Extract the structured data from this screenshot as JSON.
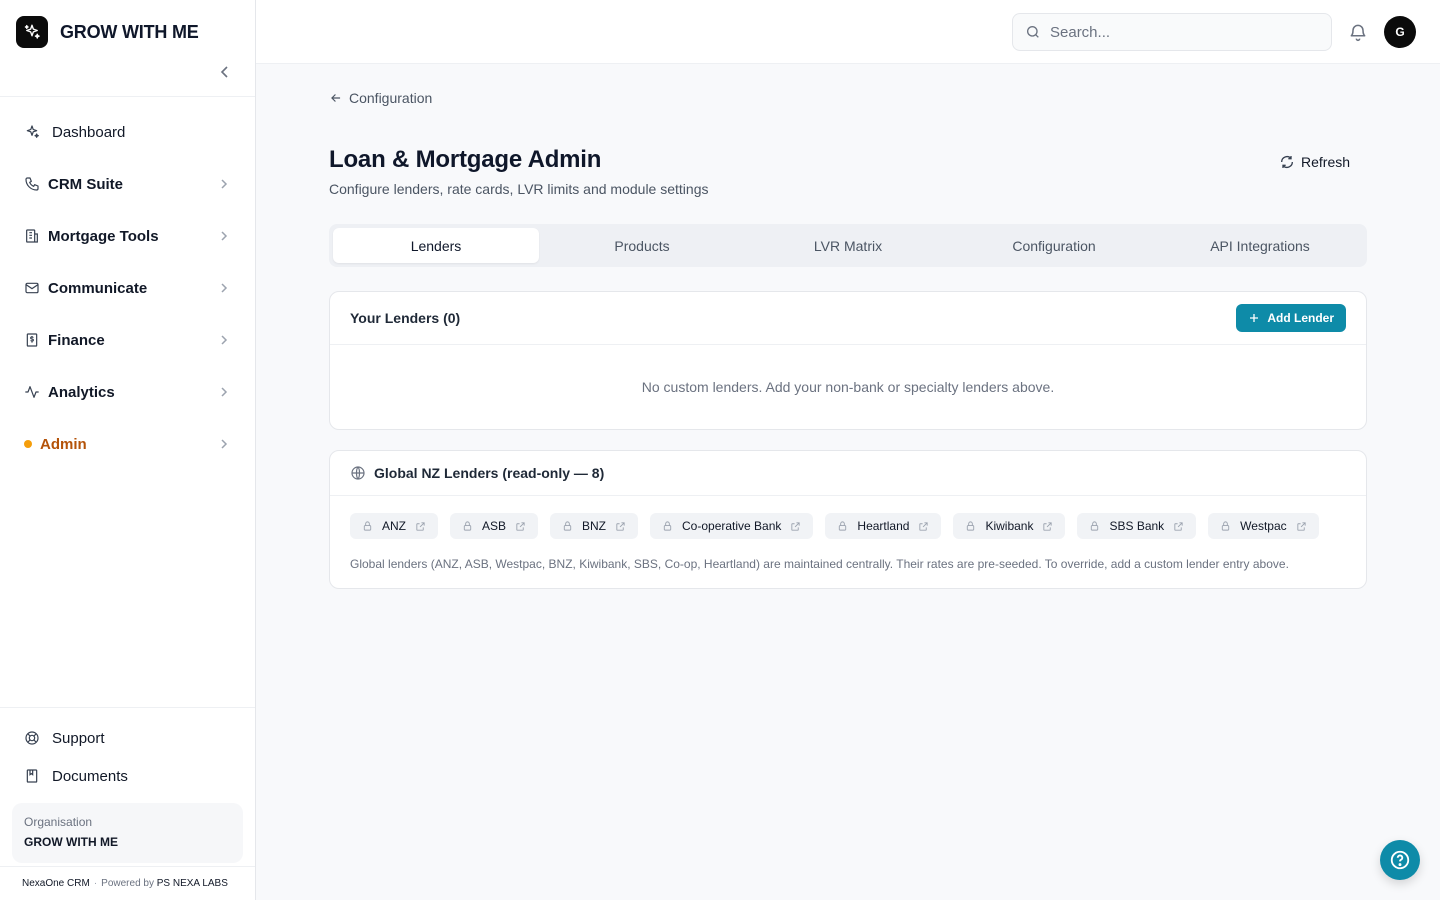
{
  "brand": {
    "name": "GROW WITH ME"
  },
  "sidebar": {
    "items": [
      {
        "label": "Dashboard",
        "icon": "sparkles-icon"
      },
      {
        "label": "CRM Suite",
        "icon": "phone-icon"
      },
      {
        "label": "Mortgage Tools",
        "icon": "building-icon"
      },
      {
        "label": "Communicate",
        "icon": "mail-icon"
      },
      {
        "label": "Finance",
        "icon": "receipt-icon"
      },
      {
        "label": "Analytics",
        "icon": "activity-icon"
      },
      {
        "label": "Admin",
        "icon": "dot-icon",
        "accent": "#b45309"
      }
    ],
    "bottom": [
      {
        "label": "Support",
        "icon": "lifebuoy-icon"
      },
      {
        "label": "Documents",
        "icon": "book-icon"
      }
    ],
    "organisation": {
      "label": "Organisation",
      "name": "GROW WITH ME"
    },
    "footer": {
      "product": "NexaOne CRM",
      "separator": "·",
      "powered_label": "Powered by",
      "company": "PS NEXA LABS"
    }
  },
  "topbar": {
    "search_placeholder": "Search...",
    "avatar_initial": "G"
  },
  "page": {
    "back_label": "Configuration",
    "title": "Loan & Mortgage Admin",
    "subtitle": "Configure lenders, rate cards, LVR limits and module settings",
    "refresh_label": "Refresh",
    "tabs": [
      {
        "label": "Lenders",
        "active": true
      },
      {
        "label": "Products",
        "active": false
      },
      {
        "label": "LVR Matrix",
        "active": false
      },
      {
        "label": "Configuration",
        "active": false
      },
      {
        "label": "API Integrations",
        "active": false
      }
    ]
  },
  "your_lenders": {
    "title": "Your Lenders (0)",
    "add_label": "Add Lender",
    "empty_text": "No custom lenders. Add your non-bank or specialty lenders above."
  },
  "global_lenders": {
    "title": "Global NZ Lenders (read-only — 8)",
    "lenders": [
      "ANZ",
      "ASB",
      "BNZ",
      "Co-operative Bank",
      "Heartland",
      "Kiwibank",
      "SBS Bank",
      "Westpac"
    ],
    "note": "Global lenders (ANZ, ASB, Westpac, BNZ, Kiwibank, SBS, Co-op, Heartland) are maintained centrally. Their rates are pre-seeded. To override, add a custom lender entry above."
  },
  "colors": {
    "accent": "#0e8ba8",
    "admin": "#b45309",
    "dot": "#f59e0b"
  }
}
